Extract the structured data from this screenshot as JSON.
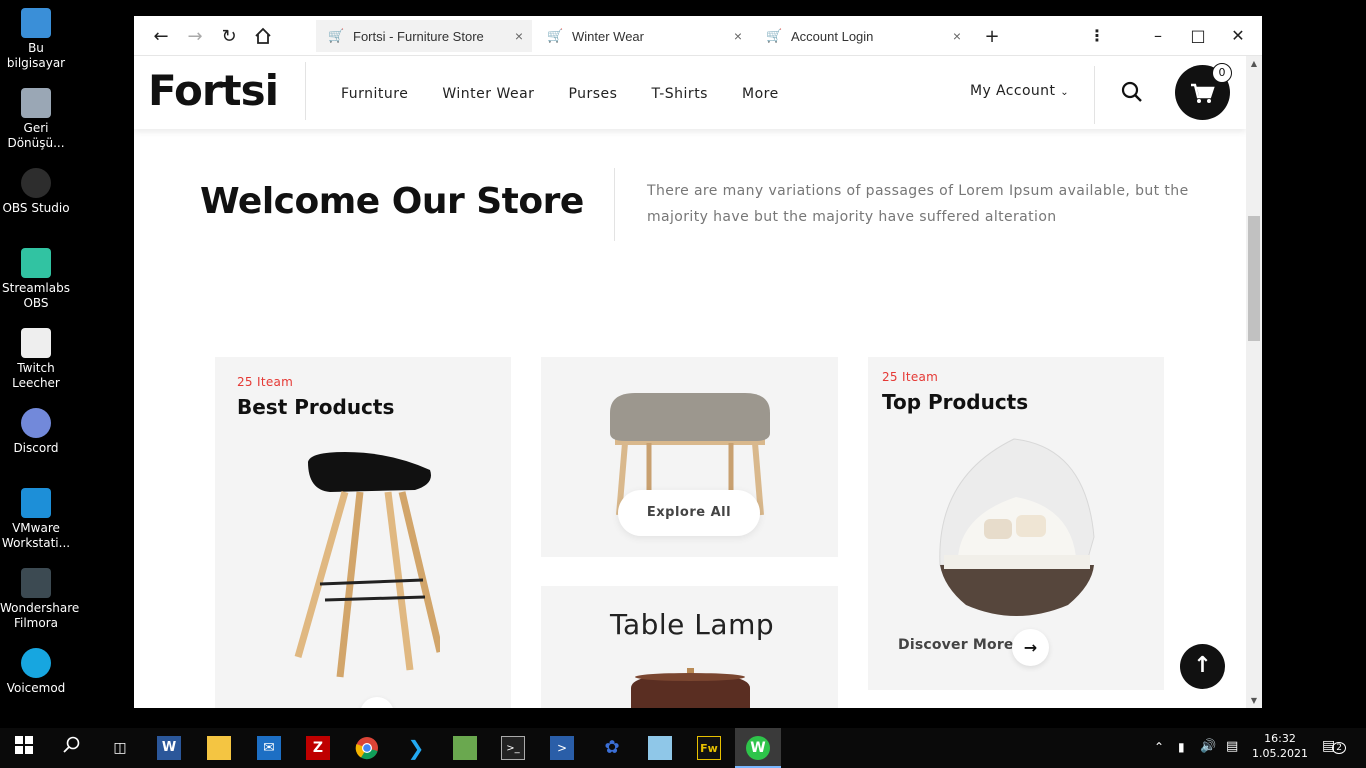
{
  "desktop": {
    "icons": [
      {
        "label": "Bu bilgisayar",
        "color": "#3a8fd8"
      },
      {
        "label": "Geri\nDönüşü...",
        "color": "#9aa7b5"
      },
      {
        "label": "OBS Studio",
        "color": "#2d2d2d"
      },
      {
        "label": "Streamlabs\nOBS",
        "color": "#31c3a2"
      },
      {
        "label": "Twitch\nLeecher",
        "color": "#eeeeee"
      },
      {
        "label": "Discord",
        "color": "#7289da"
      },
      {
        "label": "VMware\nWorkstati...",
        "color": "#1d8fd8"
      },
      {
        "label": "Wondershare\nFilmora",
        "color": "#3c4a52"
      },
      {
        "label": "Voicemod",
        "color": "#17a6e0"
      }
    ]
  },
  "browser": {
    "tabs": [
      {
        "title": "Fortsi - Furniture Store",
        "active": true
      },
      {
        "title": "Winter Wear",
        "active": false
      },
      {
        "title": "Account Login",
        "active": false
      }
    ],
    "new_tab": "+"
  },
  "site": {
    "logo": "Fortsi",
    "nav": [
      "Furniture",
      "Winter Wear",
      "Purses",
      "T-Shirts",
      "More"
    ],
    "account": "My Account",
    "cart_count": "0",
    "welcome_title": "Welcome Our Store",
    "welcome_text": "There are many variations of passages of Lorem Ipsum available, but the majority have but the majority have suffered alteration",
    "card1": {
      "count": "25 Iteam",
      "title": "Best Products"
    },
    "card2": {
      "button": "Explore All"
    },
    "card3": {
      "title": "Table Lamp"
    },
    "card4": {
      "count": "25 Iteam",
      "title": "Top Products",
      "link": "Discover More"
    }
  },
  "taskbar": {
    "time": "16:32",
    "date": "1.05.2021",
    "notifications": "2"
  }
}
